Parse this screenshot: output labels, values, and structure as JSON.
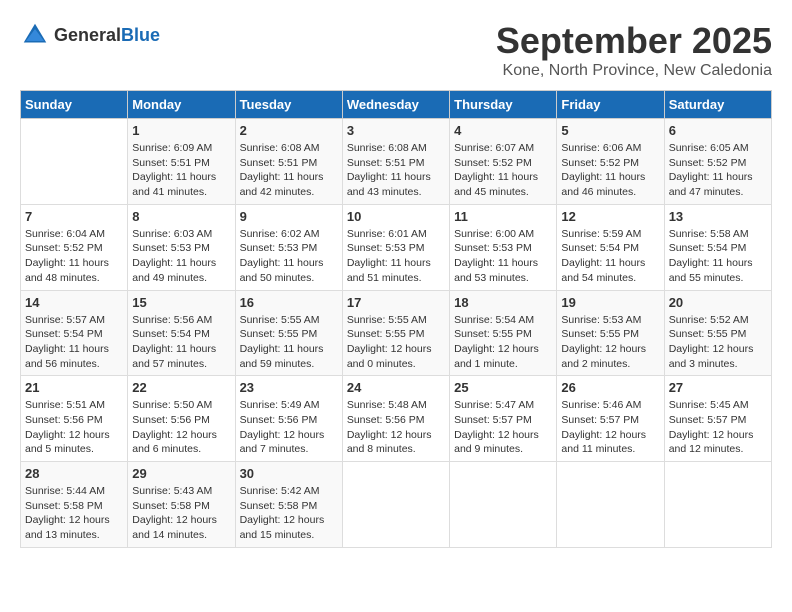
{
  "header": {
    "logo_general": "General",
    "logo_blue": "Blue",
    "month": "September 2025",
    "location": "Kone, North Province, New Caledonia"
  },
  "weekdays": [
    "Sunday",
    "Monday",
    "Tuesday",
    "Wednesday",
    "Thursday",
    "Friday",
    "Saturday"
  ],
  "weeks": [
    [
      {
        "day": "",
        "sunrise": "",
        "sunset": "",
        "daylight": ""
      },
      {
        "day": "1",
        "sunrise": "Sunrise: 6:09 AM",
        "sunset": "Sunset: 5:51 PM",
        "daylight": "Daylight: 11 hours and 41 minutes."
      },
      {
        "day": "2",
        "sunrise": "Sunrise: 6:08 AM",
        "sunset": "Sunset: 5:51 PM",
        "daylight": "Daylight: 11 hours and 42 minutes."
      },
      {
        "day": "3",
        "sunrise": "Sunrise: 6:08 AM",
        "sunset": "Sunset: 5:51 PM",
        "daylight": "Daylight: 11 hours and 43 minutes."
      },
      {
        "day": "4",
        "sunrise": "Sunrise: 6:07 AM",
        "sunset": "Sunset: 5:52 PM",
        "daylight": "Daylight: 11 hours and 45 minutes."
      },
      {
        "day": "5",
        "sunrise": "Sunrise: 6:06 AM",
        "sunset": "Sunset: 5:52 PM",
        "daylight": "Daylight: 11 hours and 46 minutes."
      },
      {
        "day": "6",
        "sunrise": "Sunrise: 6:05 AM",
        "sunset": "Sunset: 5:52 PM",
        "daylight": "Daylight: 11 hours and 47 minutes."
      }
    ],
    [
      {
        "day": "7",
        "sunrise": "Sunrise: 6:04 AM",
        "sunset": "Sunset: 5:52 PM",
        "daylight": "Daylight: 11 hours and 48 minutes."
      },
      {
        "day": "8",
        "sunrise": "Sunrise: 6:03 AM",
        "sunset": "Sunset: 5:53 PM",
        "daylight": "Daylight: 11 hours and 49 minutes."
      },
      {
        "day": "9",
        "sunrise": "Sunrise: 6:02 AM",
        "sunset": "Sunset: 5:53 PM",
        "daylight": "Daylight: 11 hours and 50 minutes."
      },
      {
        "day": "10",
        "sunrise": "Sunrise: 6:01 AM",
        "sunset": "Sunset: 5:53 PM",
        "daylight": "Daylight: 11 hours and 51 minutes."
      },
      {
        "day": "11",
        "sunrise": "Sunrise: 6:00 AM",
        "sunset": "Sunset: 5:53 PM",
        "daylight": "Daylight: 11 hours and 53 minutes."
      },
      {
        "day": "12",
        "sunrise": "Sunrise: 5:59 AM",
        "sunset": "Sunset: 5:54 PM",
        "daylight": "Daylight: 11 hours and 54 minutes."
      },
      {
        "day": "13",
        "sunrise": "Sunrise: 5:58 AM",
        "sunset": "Sunset: 5:54 PM",
        "daylight": "Daylight: 11 hours and 55 minutes."
      }
    ],
    [
      {
        "day": "14",
        "sunrise": "Sunrise: 5:57 AM",
        "sunset": "Sunset: 5:54 PM",
        "daylight": "Daylight: 11 hours and 56 minutes."
      },
      {
        "day": "15",
        "sunrise": "Sunrise: 5:56 AM",
        "sunset": "Sunset: 5:54 PM",
        "daylight": "Daylight: 11 hours and 57 minutes."
      },
      {
        "day": "16",
        "sunrise": "Sunrise: 5:55 AM",
        "sunset": "Sunset: 5:55 PM",
        "daylight": "Daylight: 11 hours and 59 minutes."
      },
      {
        "day": "17",
        "sunrise": "Sunrise: 5:55 AM",
        "sunset": "Sunset: 5:55 PM",
        "daylight": "Daylight: 12 hours and 0 minutes."
      },
      {
        "day": "18",
        "sunrise": "Sunrise: 5:54 AM",
        "sunset": "Sunset: 5:55 PM",
        "daylight": "Daylight: 12 hours and 1 minute."
      },
      {
        "day": "19",
        "sunrise": "Sunrise: 5:53 AM",
        "sunset": "Sunset: 5:55 PM",
        "daylight": "Daylight: 12 hours and 2 minutes."
      },
      {
        "day": "20",
        "sunrise": "Sunrise: 5:52 AM",
        "sunset": "Sunset: 5:55 PM",
        "daylight": "Daylight: 12 hours and 3 minutes."
      }
    ],
    [
      {
        "day": "21",
        "sunrise": "Sunrise: 5:51 AM",
        "sunset": "Sunset: 5:56 PM",
        "daylight": "Daylight: 12 hours and 5 minutes."
      },
      {
        "day": "22",
        "sunrise": "Sunrise: 5:50 AM",
        "sunset": "Sunset: 5:56 PM",
        "daylight": "Daylight: 12 hours and 6 minutes."
      },
      {
        "day": "23",
        "sunrise": "Sunrise: 5:49 AM",
        "sunset": "Sunset: 5:56 PM",
        "daylight": "Daylight: 12 hours and 7 minutes."
      },
      {
        "day": "24",
        "sunrise": "Sunrise: 5:48 AM",
        "sunset": "Sunset: 5:56 PM",
        "daylight": "Daylight: 12 hours and 8 minutes."
      },
      {
        "day": "25",
        "sunrise": "Sunrise: 5:47 AM",
        "sunset": "Sunset: 5:57 PM",
        "daylight": "Daylight: 12 hours and 9 minutes."
      },
      {
        "day": "26",
        "sunrise": "Sunrise: 5:46 AM",
        "sunset": "Sunset: 5:57 PM",
        "daylight": "Daylight: 12 hours and 11 minutes."
      },
      {
        "day": "27",
        "sunrise": "Sunrise: 5:45 AM",
        "sunset": "Sunset: 5:57 PM",
        "daylight": "Daylight: 12 hours and 12 minutes."
      }
    ],
    [
      {
        "day": "28",
        "sunrise": "Sunrise: 5:44 AM",
        "sunset": "Sunset: 5:58 PM",
        "daylight": "Daylight: 12 hours and 13 minutes."
      },
      {
        "day": "29",
        "sunrise": "Sunrise: 5:43 AM",
        "sunset": "Sunset: 5:58 PM",
        "daylight": "Daylight: 12 hours and 14 minutes."
      },
      {
        "day": "30",
        "sunrise": "Sunrise: 5:42 AM",
        "sunset": "Sunset: 5:58 PM",
        "daylight": "Daylight: 12 hours and 15 minutes."
      },
      {
        "day": "",
        "sunrise": "",
        "sunset": "",
        "daylight": ""
      },
      {
        "day": "",
        "sunrise": "",
        "sunset": "",
        "daylight": ""
      },
      {
        "day": "",
        "sunrise": "",
        "sunset": "",
        "daylight": ""
      },
      {
        "day": "",
        "sunrise": "",
        "sunset": "",
        "daylight": ""
      }
    ]
  ]
}
